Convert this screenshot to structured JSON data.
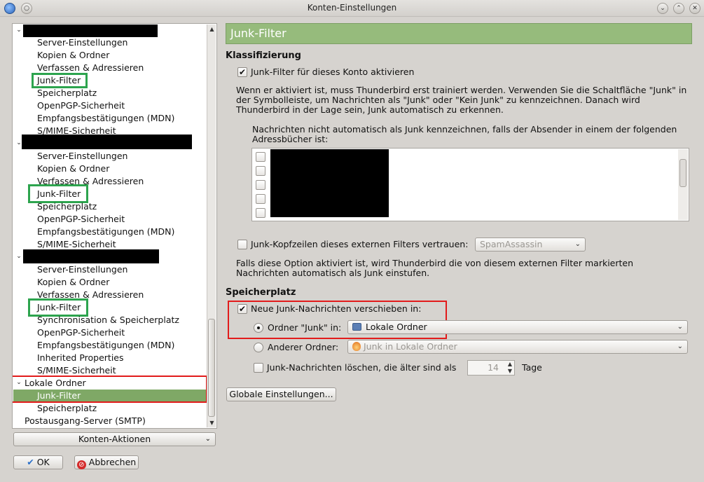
{
  "window": {
    "title": "Konten-Einstellungen"
  },
  "tree": {
    "account_items": [
      "Server-Einstellungen",
      "Kopien & Ordner",
      "Verfassen & Adressieren",
      "Junk-Filter",
      "Speicherplatz",
      "OpenPGP-Sicherheit",
      "Empfangsbestätigungen (MDN)",
      "S/MIME-Sicherheit"
    ],
    "account3_items": [
      "Server-Einstellungen",
      "Kopien & Ordner",
      "Verfassen & Adressieren",
      "Junk-Filter",
      "Synchronisation & Speicherplatz",
      "OpenPGP-Sicherheit",
      "Empfangsbestätigungen (MDN)",
      "Inherited Properties",
      "S/MIME-Sicherheit"
    ],
    "local_folders": "Lokale Ordner",
    "local_junk": "Junk-Filter",
    "local_storage": "Speicherplatz",
    "smtp": "Postausgang-Server (SMTP)"
  },
  "left_buttons": {
    "account_actions": "Konten-Aktionen",
    "ok": "OK",
    "cancel": "Abbrechen"
  },
  "panel": {
    "title": "Junk-Filter",
    "classification": {
      "heading": "Klassifizierung",
      "enable_label": "Junk-Filter für dieses Konto aktivieren",
      "enable_checked": true,
      "description": "Wenn er aktiviert ist, muss Thunderbird erst trainiert werden. Verwenden Sie die Schaltfläche \"Junk\" in der Symbolleiste, um Nachrichten als \"Junk\" oder \"Kein Junk\" zu kennzeichnen. Danach wird Thunderbird in der Lage sein, Junk automatisch zu erkennen.",
      "whitelist_label": "Nachrichten nicht automatisch als Junk kennzeichnen, falls der Absender in einem der folgenden Adressbücher ist:",
      "trust_headers_label": "Junk-Kopfzeilen dieses externen Filters vertrauen:",
      "trust_headers_checked": false,
      "filter_select": "SpamAssassin",
      "trust_description": "Falls diese Option aktiviert ist, wird Thunderbird die von diesem externen Filter markierten Nachrichten automatisch als Junk einstufen."
    },
    "storage": {
      "heading": "Speicherplatz",
      "move_label": "Neue Junk-Nachrichten verschieben in:",
      "move_checked": true,
      "junk_folder_label": "Ordner \"Junk\" in:",
      "junk_folder_select": "Lokale Ordner",
      "other_folder_label": "Anderer Ordner:",
      "other_folder_select": "Junk in Lokale Ordner",
      "delete_label": "Junk-Nachrichten löschen, die älter sind als",
      "delete_checked": false,
      "days_value": "14",
      "days_unit": "Tage"
    },
    "global_button": "Globale Einstellungen..."
  },
  "colors": {
    "header": "#96bb7c",
    "selection": "#7fa866",
    "highlight_green": "#2da44e",
    "highlight_red": "#e21b1b"
  }
}
